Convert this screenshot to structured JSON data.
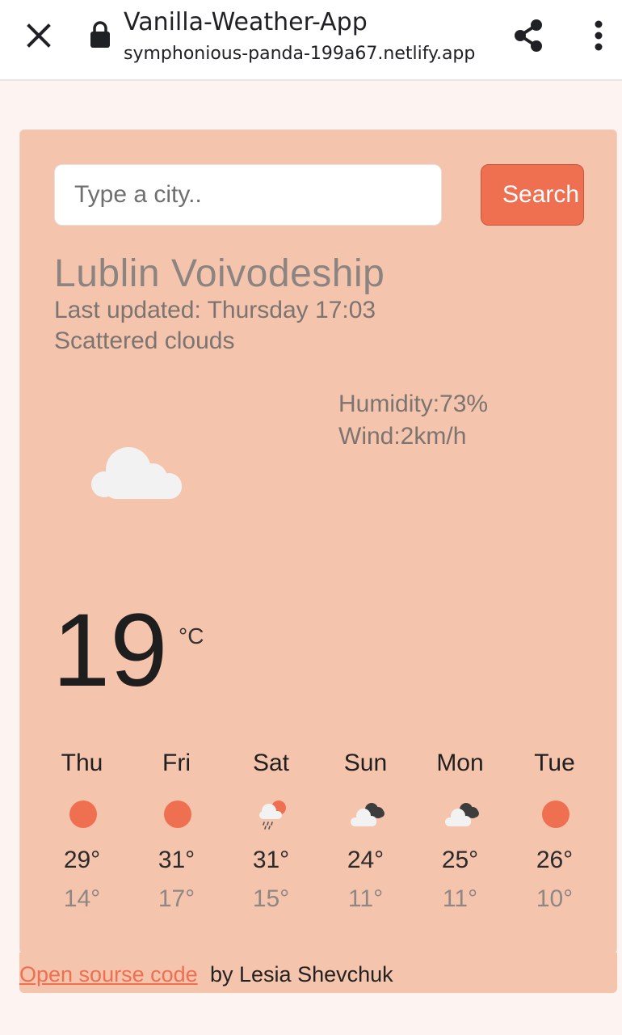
{
  "browser": {
    "title": "Vanilla-Weather-App",
    "url": "symphonious-panda-199a67.netlify.app",
    "icons": {
      "close": "close-icon",
      "lock": "lock-icon",
      "share": "share-icon",
      "menu": "more-vert-icon"
    }
  },
  "search": {
    "placeholder": "Type a city..",
    "value": "",
    "button_label": "Search"
  },
  "current": {
    "city": "Lublin Voivodeship",
    "last_updated": "Last updated: Thursday 17:03",
    "description": "Scattered clouds",
    "humidity": "Humidity:73%",
    "wind": "Wind:2km/h",
    "temperature": "19",
    "unit": "°C",
    "icon": "scattered-clouds-icon"
  },
  "forecast": [
    {
      "day": "Thu",
      "max": "29°",
      "min": "14°",
      "icon": "sun-icon"
    },
    {
      "day": "Fri",
      "max": "31°",
      "min": "17°",
      "icon": "sun-icon"
    },
    {
      "day": "Sat",
      "max": "31°",
      "min": "15°",
      "icon": "rain-cloud-sun-icon"
    },
    {
      "day": "Sun",
      "max": "24°",
      "min": "11°",
      "icon": "broken-clouds-icon"
    },
    {
      "day": "Mon",
      "max": "25°",
      "min": "11°",
      "icon": "broken-clouds-icon"
    },
    {
      "day": "Tue",
      "max": "26°",
      "min": "10°",
      "icon": "sun-icon"
    }
  ],
  "footer": {
    "link_text": "Open sourse code ",
    "author_text": "by Lesia Shevchuk"
  },
  "colors": {
    "accent": "#ef6f51",
    "card_background": "#f5c4ad",
    "page_background": "#fdf3f1"
  }
}
